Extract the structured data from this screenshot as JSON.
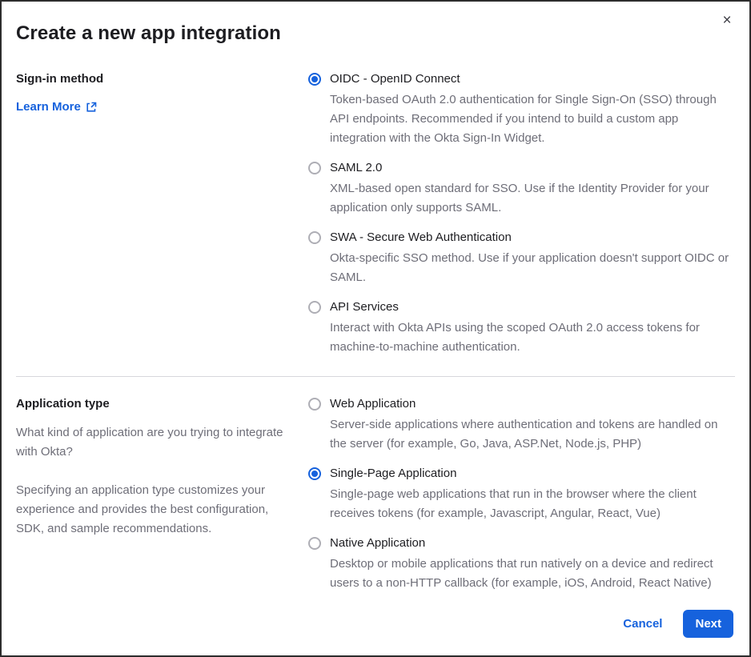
{
  "modal": {
    "title": "Create a new app integration",
    "close_icon": "×"
  },
  "signin_section": {
    "label": "Sign-in method",
    "learn_more_label": "Learn More",
    "options": [
      {
        "label": "OIDC - OpenID Connect",
        "description": "Token-based OAuth 2.0 authentication for Single Sign-On (SSO) through API endpoints. Recommended if you intend to build a custom app integration with the Okta Sign-In Widget.",
        "selected": true
      },
      {
        "label": "SAML 2.0",
        "description": "XML-based open standard for SSO. Use if the Identity Provider for your application only supports SAML.",
        "selected": false
      },
      {
        "label": "SWA - Secure Web Authentication",
        "description": "Okta-specific SSO method. Use if your application doesn't support OIDC or SAML.",
        "selected": false
      },
      {
        "label": "API Services",
        "description": "Interact with Okta APIs using the scoped OAuth 2.0 access tokens for machine-to-machine authentication.",
        "selected": false
      }
    ]
  },
  "apptype_section": {
    "label": "Application type",
    "description_1": "What kind of application are you trying to integrate with Okta?",
    "description_2": "Specifying an application type customizes your experience and provides the best configuration, SDK, and sample recommendations.",
    "options": [
      {
        "label": "Web Application",
        "description": "Server-side applications where authentication and tokens are handled on the server (for example, Go, Java, ASP.Net, Node.js, PHP)",
        "selected": false
      },
      {
        "label": "Single-Page Application",
        "description": "Single-page web applications that run in the browser where the client receives tokens (for example, Javascript, Angular, React, Vue)",
        "selected": true
      },
      {
        "label": "Native Application",
        "description": "Desktop or mobile applications that run natively on a device and redirect users to a non-HTTP callback (for example, iOS, Android, React Native)",
        "selected": false
      }
    ]
  },
  "footer": {
    "cancel_label": "Cancel",
    "next_label": "Next"
  },
  "colors": {
    "accent_blue": "#1662dd",
    "text_dark": "#1d1d21",
    "text_gray": "#6e6e78",
    "divider": "#d7d7dc"
  }
}
